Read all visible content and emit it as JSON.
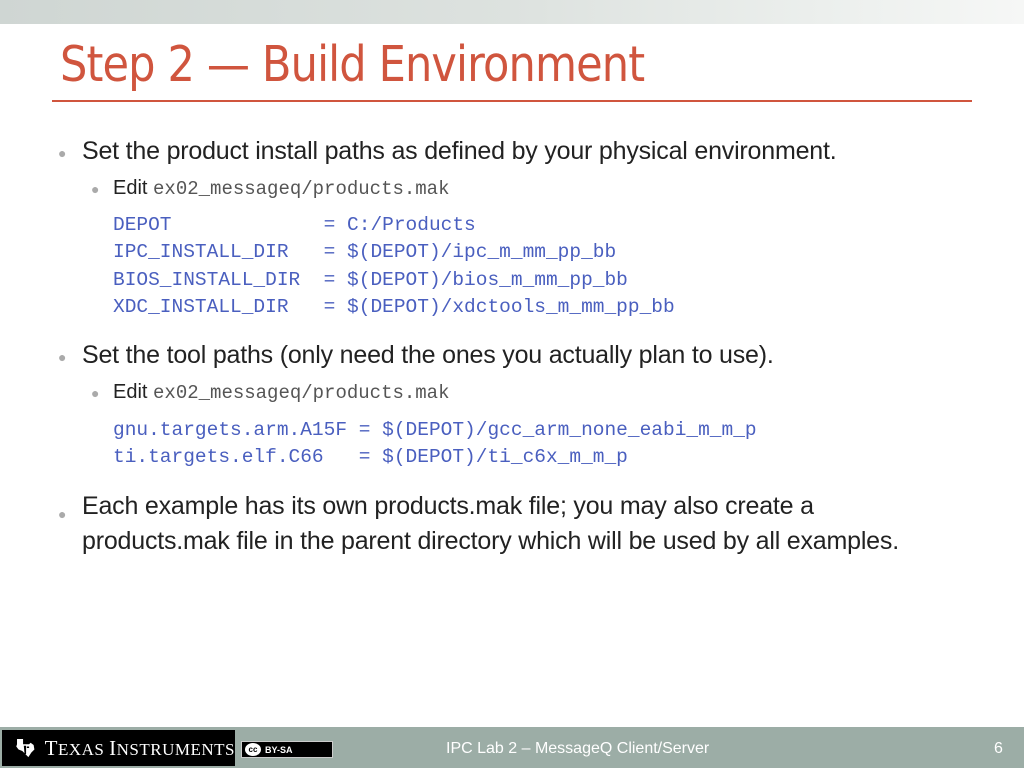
{
  "slide": {
    "title": "Step 2 — Build Environment",
    "bullets": [
      {
        "text": "Set the product install paths as defined by your physical environment.",
        "sub": {
          "label": "Edit",
          "path": "ex02_messageq/products.mak"
        },
        "code": [
          "DEPOT             = C:/Products",
          "IPC_INSTALL_DIR   = $(DEPOT)/ipc_m_mm_pp_bb",
          "BIOS_INSTALL_DIR  = $(DEPOT)/bios_m_mm_pp_bb",
          "XDC_INSTALL_DIR   = $(DEPOT)/xdctools_m_mm_pp_bb"
        ]
      },
      {
        "text": "Set the tool paths (only need the ones you actually plan to use).",
        "sub": {
          "label": "Edit",
          "path": "ex02_messageq/products.mak"
        },
        "code": [
          "gnu.targets.arm.A15F = $(DEPOT)/gcc_arm_none_eabi_m_m_p",
          "ti.targets.elf.C66   = $(DEPOT)/ti_c6x_m_m_p"
        ]
      },
      {
        "text": "Each example has its own products.mak file; you may also create a products.mak file in the parent directory which will be used by all examples."
      }
    ]
  },
  "footer": {
    "logo_text_1": "T",
    "logo_text_2": "EXAS ",
    "logo_text_3": "I",
    "logo_text_4": "NSTRUMENTS",
    "license_symbol": "cc",
    "license_label": "BY-SA",
    "presentation_title": "IPC Lab 2 – MessageQ Client/Server",
    "page_number": "6"
  },
  "colors": {
    "title": "#d0553e",
    "code": "#4a5fbf",
    "footer_bg": "#9cada6"
  }
}
